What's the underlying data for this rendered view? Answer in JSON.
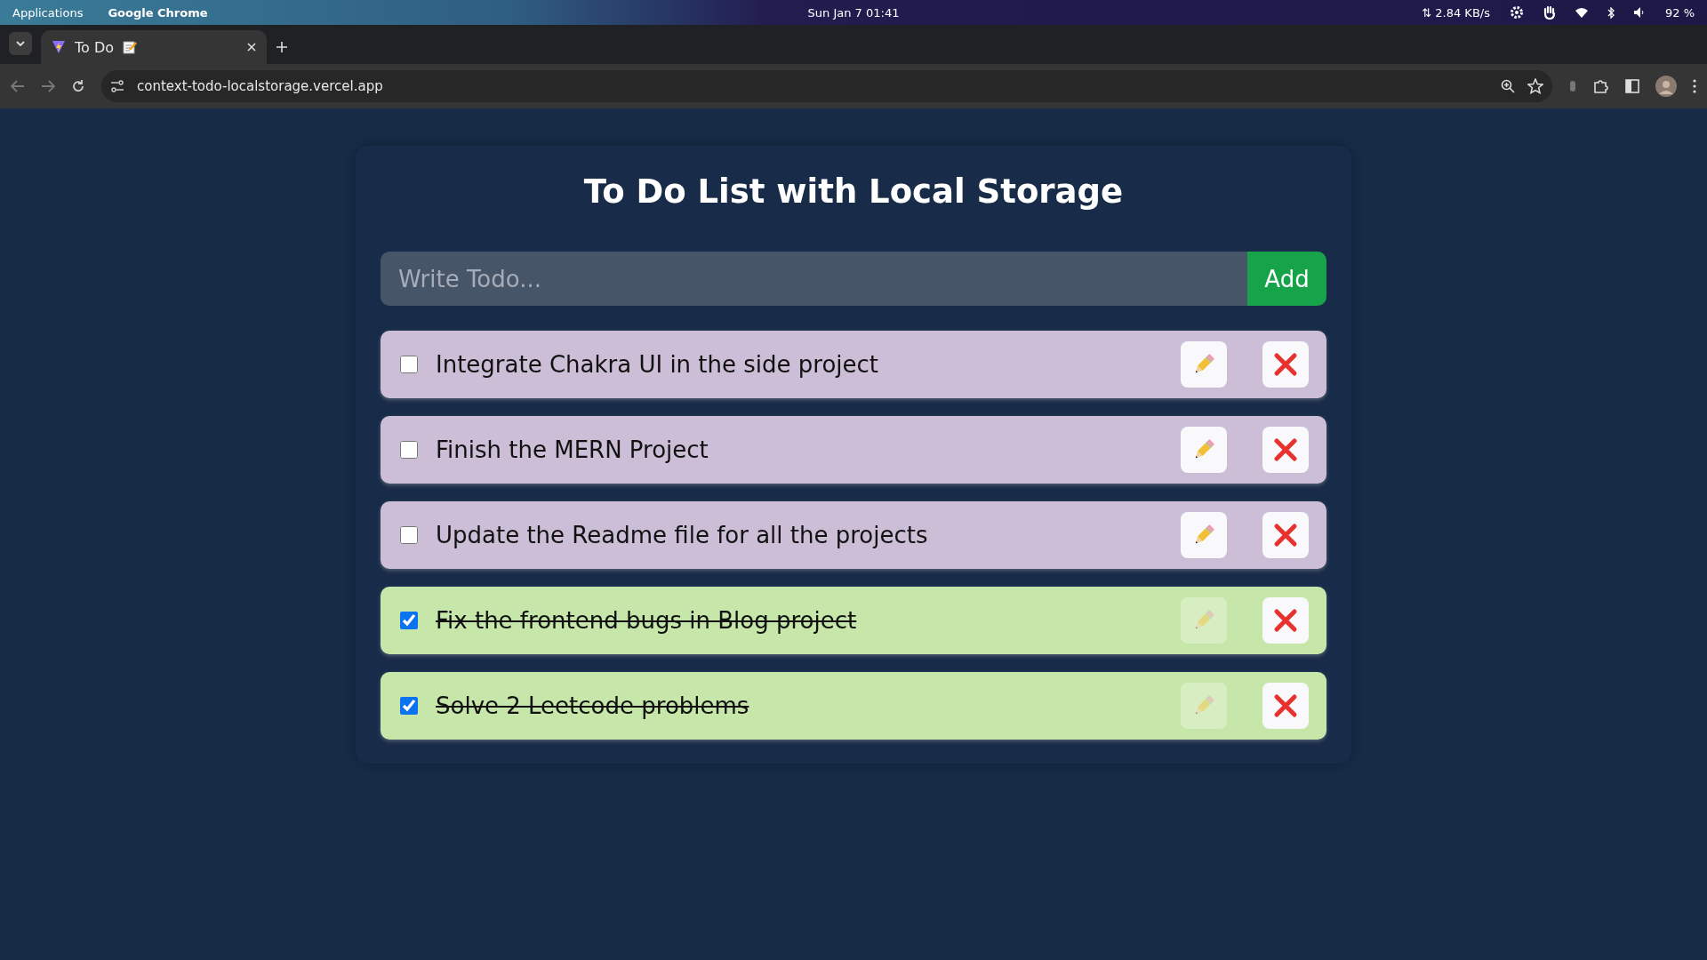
{
  "system_bar": {
    "menu": "Applications",
    "app": "Google Chrome",
    "clock": "Sun Jan 7  01:41",
    "network_speed": "⇅ 2.84 KB/s",
    "battery": "92 %"
  },
  "browser": {
    "tab": {
      "title": "To Do",
      "selected": true
    },
    "url": "context-todo-localstorage.vercel.app"
  },
  "page": {
    "title": "To Do List with Local Storage",
    "input": {
      "placeholder": "Write Todo..."
    },
    "add_button": "Add",
    "todos": [
      {
        "text": "Integrate Chakra UI in the side project",
        "completed": false
      },
      {
        "text": "Finish the MERN Project",
        "completed": false
      },
      {
        "text": "Update the Readme file for all the projects",
        "completed": false
      },
      {
        "text": "Fix the frontend bugs in Blog project",
        "completed": true
      },
      {
        "text": "Solve 2 Leetcode problems",
        "completed": true
      }
    ]
  }
}
